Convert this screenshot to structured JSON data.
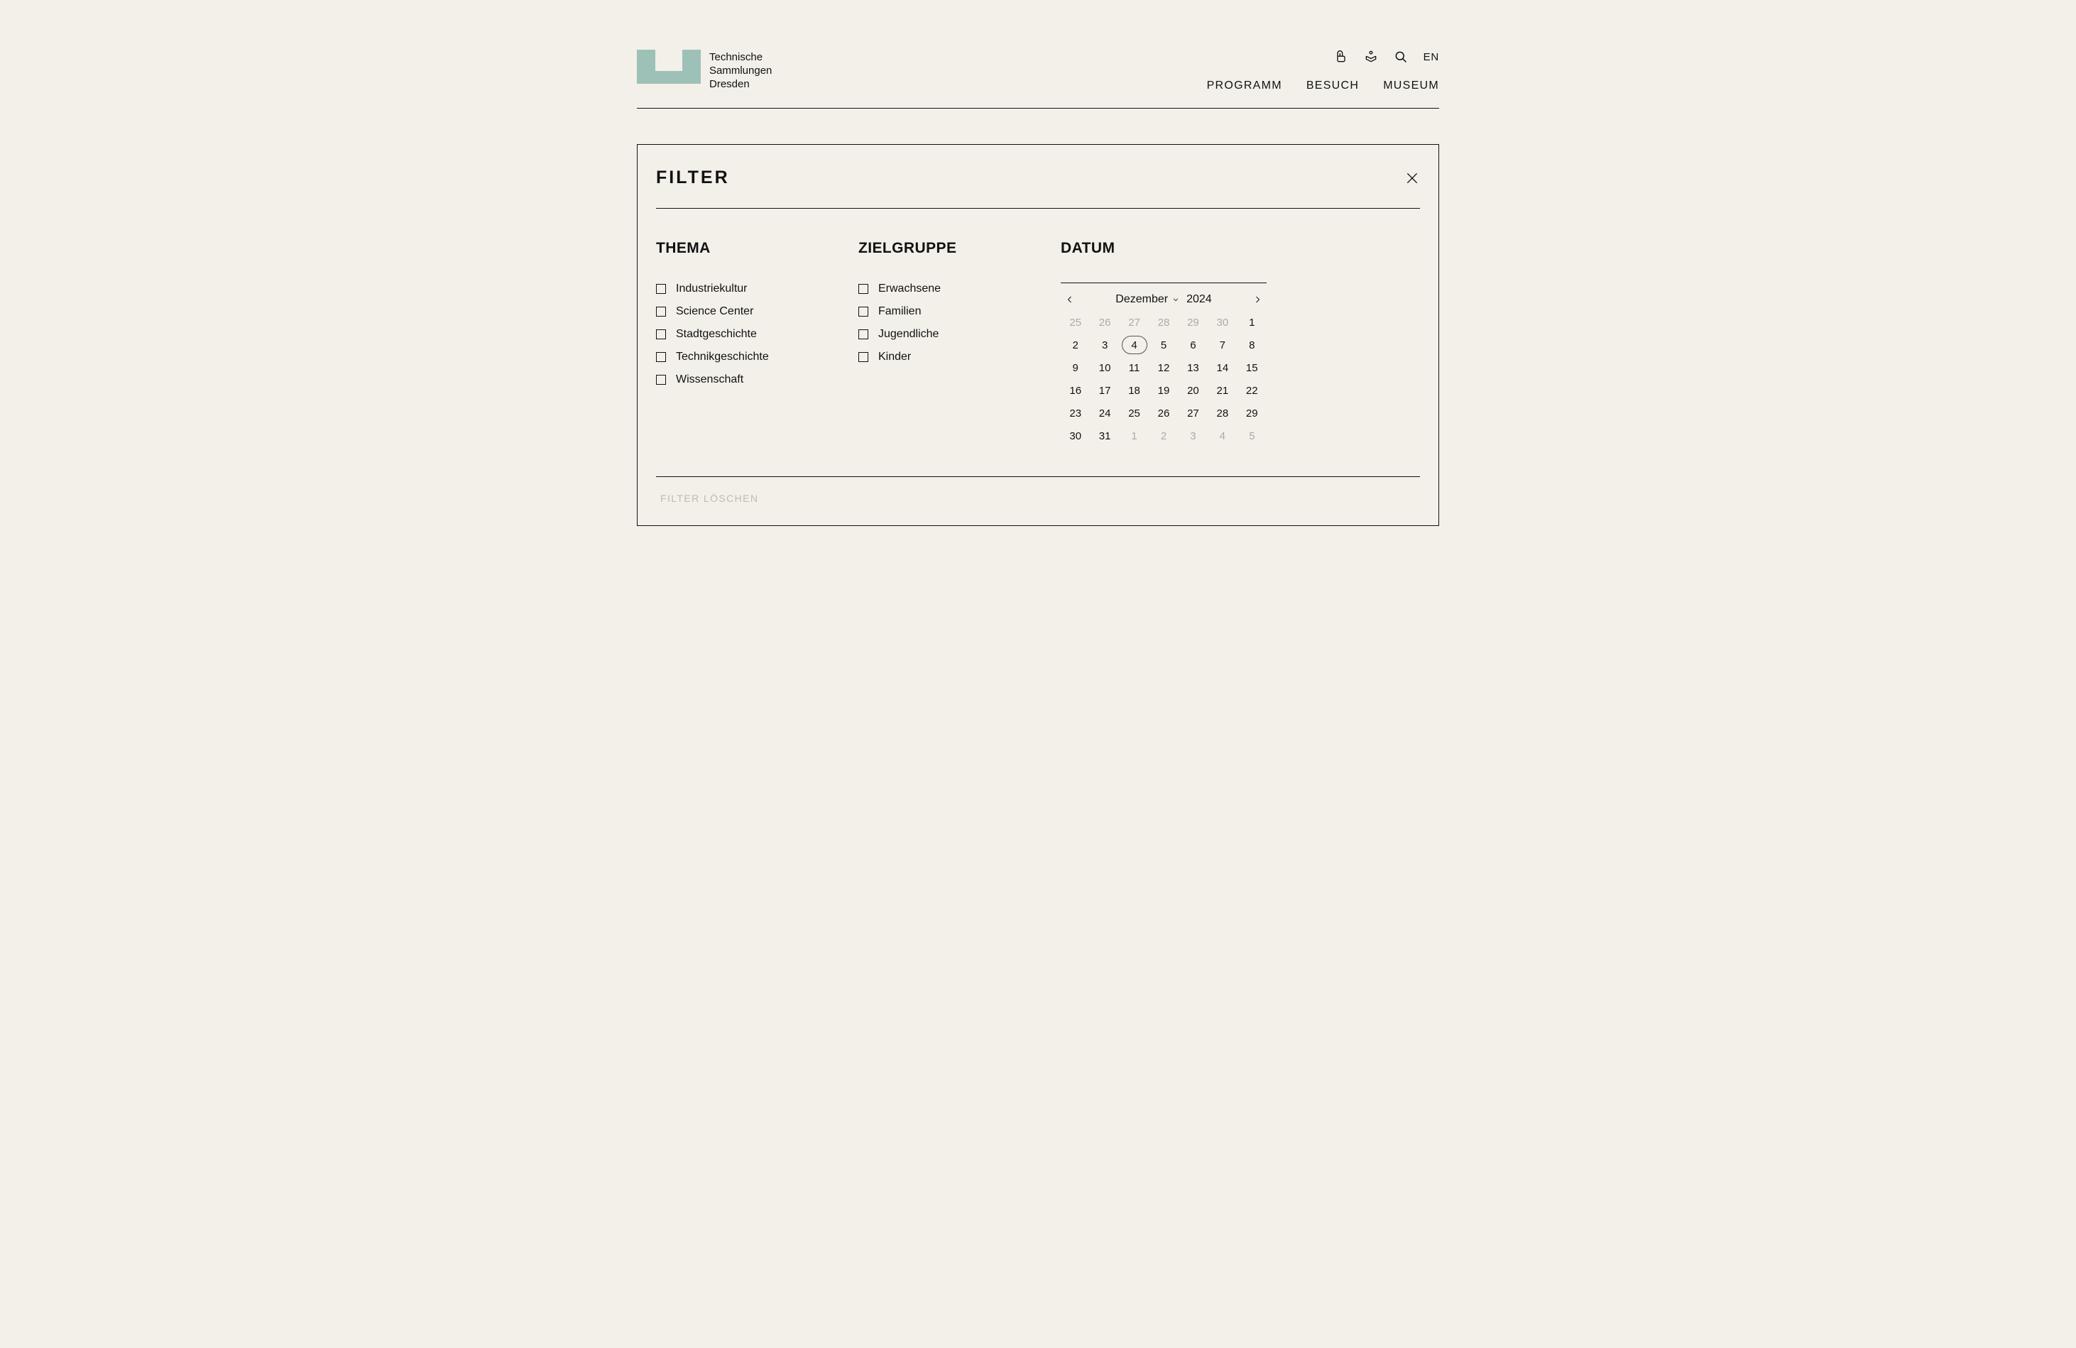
{
  "brand": {
    "line1": "Technische",
    "line2": "Sammlungen",
    "line3": "Dresden"
  },
  "header": {
    "lang": "EN",
    "nav": [
      {
        "key": "programm",
        "label": "PROGRAMM"
      },
      {
        "key": "besuch",
        "label": "BESUCH"
      },
      {
        "key": "museum",
        "label": "MUSEUM"
      }
    ]
  },
  "filter": {
    "title": "FILTER",
    "clear_label": "FILTER LÖSCHEN",
    "columns": {
      "thema": {
        "title": "THEMA",
        "items": [
          "Industriekultur",
          "Science Center",
          "Stadtgeschichte",
          "Technikgeschichte",
          "Wissenschaft"
        ]
      },
      "zielgruppe": {
        "title": "ZIELGRUPPE",
        "items": [
          "Erwachsene",
          "Familien",
          "Jugendliche",
          "Kinder"
        ]
      },
      "datum": {
        "title": "DATUM"
      }
    }
  },
  "calendar": {
    "month_label": "Dezember",
    "year_label": "2024",
    "today": 4,
    "weeks": [
      [
        {
          "d": 25,
          "o": true
        },
        {
          "d": 26,
          "o": true
        },
        {
          "d": 27,
          "o": true
        },
        {
          "d": 28,
          "o": true
        },
        {
          "d": 29,
          "o": true
        },
        {
          "d": 30,
          "o": true
        },
        {
          "d": 1
        }
      ],
      [
        {
          "d": 2
        },
        {
          "d": 3
        },
        {
          "d": 4,
          "today": true
        },
        {
          "d": 5
        },
        {
          "d": 6
        },
        {
          "d": 7
        },
        {
          "d": 8
        }
      ],
      [
        {
          "d": 9
        },
        {
          "d": 10
        },
        {
          "d": 11
        },
        {
          "d": 12
        },
        {
          "d": 13
        },
        {
          "d": 14
        },
        {
          "d": 15
        }
      ],
      [
        {
          "d": 16
        },
        {
          "d": 17
        },
        {
          "d": 18
        },
        {
          "d": 19
        },
        {
          "d": 20
        },
        {
          "d": 21
        },
        {
          "d": 22
        }
      ],
      [
        {
          "d": 23
        },
        {
          "d": 24
        },
        {
          "d": 25
        },
        {
          "d": 26
        },
        {
          "d": 27
        },
        {
          "d": 28
        },
        {
          "d": 29
        }
      ],
      [
        {
          "d": 30
        },
        {
          "d": 31
        },
        {
          "d": 1,
          "o": true
        },
        {
          "d": 2,
          "o": true
        },
        {
          "d": 3,
          "o": true
        },
        {
          "d": 4,
          "o": true
        },
        {
          "d": 5,
          "o": true
        }
      ]
    ]
  }
}
